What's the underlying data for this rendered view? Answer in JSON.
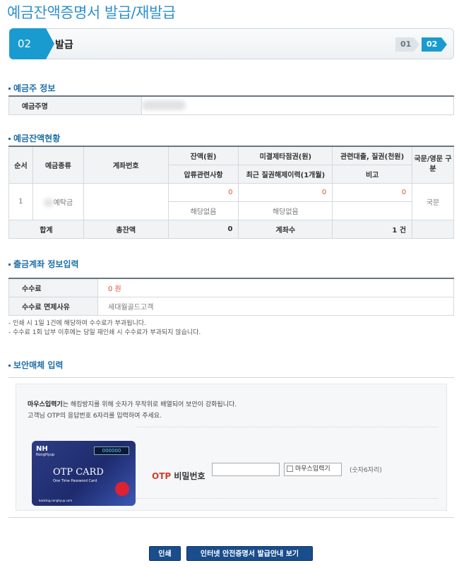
{
  "page": {
    "title": "예금잔액증명서 발급/재발급"
  },
  "stepper": {
    "current_num": "02",
    "current_label": "발급",
    "step1": "01",
    "step2": "02"
  },
  "depositor": {
    "section_title": "예금주 정보",
    "label": "예금주명"
  },
  "balance": {
    "section_title": "예금잔액현황",
    "headers": {
      "seq": "순서",
      "type": "예금종류",
      "account": "계좌번호",
      "balance": "잔액(원)",
      "unpaid_bill": "미결제타점권(원)",
      "loan": "관련대출, 질권(천원)",
      "lang": "국문/영문 구분",
      "seizure": "압류관련사항",
      "pledge_release": "최근 질권해제이력(1개월)",
      "note": "비고"
    },
    "rows": [
      {
        "seq": "1",
        "type": "예탁금",
        "balance": "0",
        "unpaid_bill": "0",
        "loan": "0",
        "lang": "국문",
        "seizure": "해당없음",
        "pledge_release": "해당없음",
        "note": ""
      }
    ],
    "total": {
      "label": "합계",
      "sum_label": "총잔액",
      "sum_value": "0",
      "count_label": "계좌수",
      "count_value": "1 건"
    }
  },
  "withdraw": {
    "section_title": "출금계좌 정보입력",
    "fee_label": "수수료",
    "fee_value": "0 원",
    "exempt_label": "수수료 면제사유",
    "exempt_value": "세대월골드고객",
    "notes": [
      "- 인쇄 시 1일 1건에 해당하여 수수료가 부과됩니다.",
      "- 수수료 1회 납부 이후에는 당일 재인쇄 시 수수료가 부과되지 않습니다."
    ]
  },
  "security": {
    "section_title": "보안매체 입력",
    "guide_bold": "마우스입력기",
    "guide_1": "는 해킹방지를 위해 숫자가 무작위로 배열되어 보안이 강화됩니다.",
    "guide_2": "고객님 OTP의 응답번호 6자리를 입력하여 주세요.",
    "otp_prefix": "OTP",
    "otp_label": "비밀번호",
    "mouse_input": "마우스입력기",
    "hint": "(숫자6자리)",
    "card": {
      "brand": "NH",
      "brand_sub": "NongHyup",
      "display": "000000",
      "title": "OTP CARD",
      "subtitle": "One Time Password Card",
      "url": "banking.nonghyup.com"
    }
  },
  "buttons": {
    "print": "인쇄",
    "guide": "인터넷 안전증명서 발급안내 보기"
  },
  "colors": {
    "accent": "#1a9bcf",
    "section": "#1f6fa8",
    "red": "#e0533a",
    "button": "#1a4d8c"
  }
}
